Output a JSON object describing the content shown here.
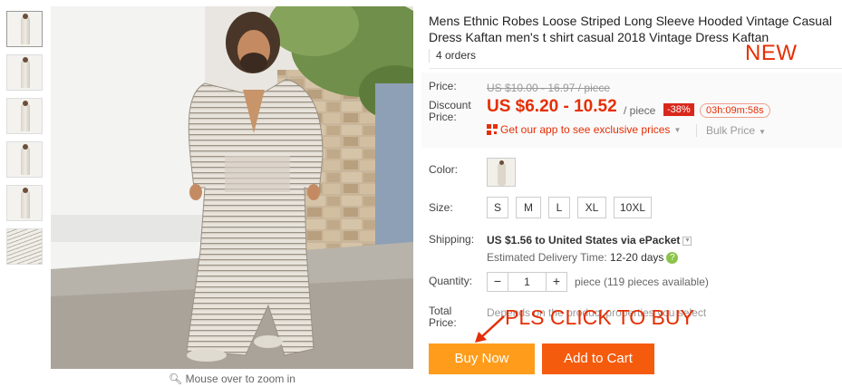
{
  "product": {
    "title": "Mens Ethnic Robes Loose Striped Long Sleeve Hooded Vintage Casual Dress Kaftan men's t shirt casual 2018 Vintage Dress Kaftan",
    "orders": "4 orders",
    "new_tag": "NEW"
  },
  "gallery": {
    "zoom_hint": "Mouse over to zoom in",
    "thumbnail_count": 6
  },
  "price": {
    "label": "Price:",
    "original": "US $10.00 - 16.97 / piece",
    "discount_label": "Discount Price:",
    "discount": "US $6.20 - 10.52",
    "per_piece": "/ piece",
    "discount_pct": "-38%",
    "countdown": "03h:09m:58s",
    "app_promo": "Get our app to see exclusive prices",
    "bulk": "Bulk Price"
  },
  "options": {
    "color_label": "Color:",
    "size_label": "Size:",
    "sizes": [
      "S",
      "M",
      "L",
      "XL",
      "10XL"
    ]
  },
  "shipping": {
    "label": "Shipping:",
    "value": "US $1.56 to United States via ePacket",
    "est_label": "Estimated Delivery Time:",
    "est_days": "12-20 days"
  },
  "quantity": {
    "label": "Quantity:",
    "value": "1",
    "minus": "−",
    "plus": "+",
    "note": "piece (119 pieces available)"
  },
  "total": {
    "label": "Total Price:",
    "value": "Depends on the product properties you select"
  },
  "annotation": "PLS CLICK TO BUY",
  "actions": {
    "buy_now": "Buy Now",
    "add_to_cart": "Add to Cart"
  },
  "colors": {
    "accent": "#e62e04",
    "buy_now": "#ff9c1b",
    "add_to_cart": "#f55b0c"
  }
}
